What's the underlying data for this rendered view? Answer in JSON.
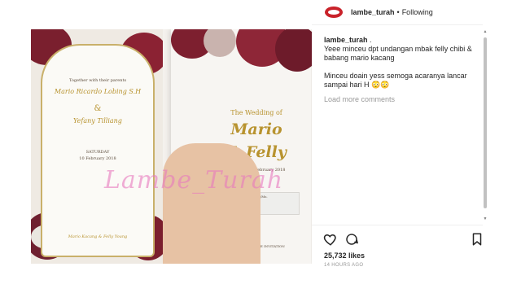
{
  "post": {
    "username": "lambe_turah",
    "separator": "•",
    "follow_state": "Following",
    "watermark": "Lambe_Turah"
  },
  "invitation_left": {
    "intro": "Together with their parents",
    "groom": "Mario Ricardo Lobing S.H",
    "amp": "&",
    "bride": "Yefany Tilliang",
    "day": "SATURDAY",
    "date": "10 February 2018",
    "footer": "Mario Kacang & Felly Young"
  },
  "invitation_right": {
    "title": "The Wedding of",
    "name1": "Mario",
    "name2": "& Felly",
    "date": "Saturday, 10 February 2018",
    "to": "To: Mr./Mrs./Ms.",
    "bring": "PLEASE BRING THE INVITATION"
  },
  "caption": {
    "username": "lambe_turah",
    "suffix": " .",
    "line1": "Yeee minceu dpt undangan mbak felly chibi & babang mario kacang",
    "line2": "Minceu doain yess semoga acaranya lancar sampai hari H 😳😳"
  },
  "load_more": "Load more comments",
  "likes": "25,732 likes",
  "timestamp": "14 HOURS AGO",
  "icons": [
    "heart-icon",
    "comment-icon",
    "bookmark-icon"
  ],
  "colors": {
    "brand_red": "#c9222a",
    "muted": "#999999",
    "gold": "#b8932f",
    "watermark": "#e878be"
  }
}
